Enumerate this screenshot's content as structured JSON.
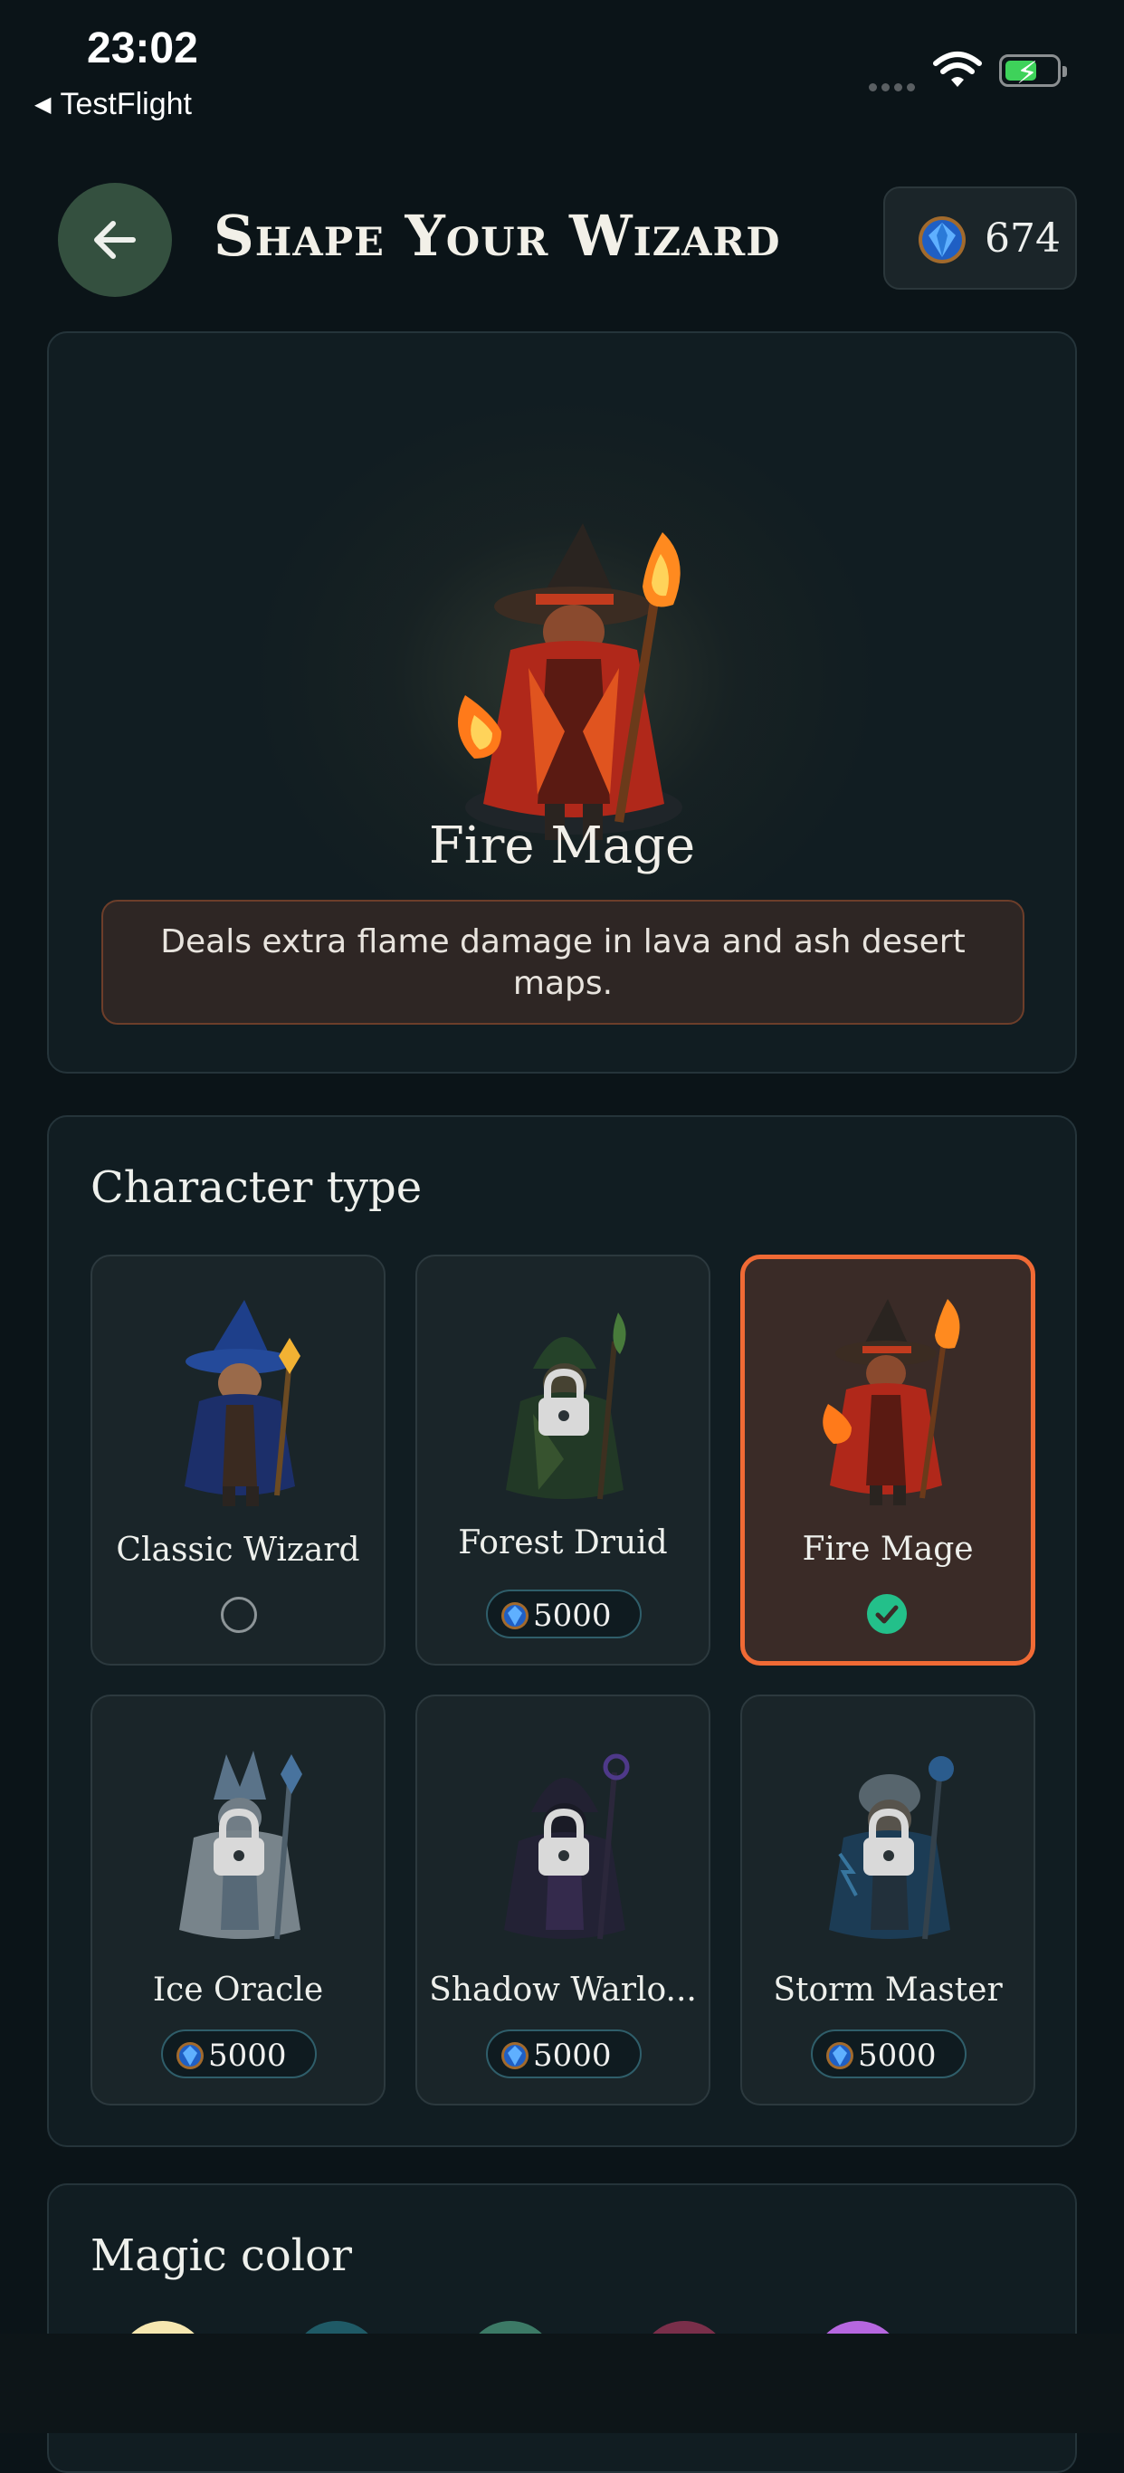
{
  "status": {
    "time": "23:02",
    "back_app": "TestFlight"
  },
  "header": {
    "title": "Shape Your Wizard",
    "gems": "674"
  },
  "preview": {
    "name": "Fire Mage",
    "description": "Deals extra flame damage in lava and ash desert maps."
  },
  "character_type": {
    "title": "Character type",
    "items": [
      {
        "name": "Classic Wizard",
        "locked": false,
        "selected": false
      },
      {
        "name": "Forest Druid",
        "locked": true,
        "price": "5000",
        "selected": false
      },
      {
        "name": "Fire Mage",
        "locked": false,
        "selected": true
      },
      {
        "name": "Ice Oracle",
        "locked": true,
        "price": "5000",
        "selected": false
      },
      {
        "name": "Shadow Warlo...",
        "locked": true,
        "price": "5000",
        "selected": false
      },
      {
        "name": "Storm Master",
        "locked": true,
        "price": "5000",
        "selected": false
      }
    ]
  },
  "magic_color": {
    "title": "Magic color",
    "swatches": [
      "#f6e7b0",
      "#1f5a66",
      "#3c7a66",
      "#7a2f4a",
      "#b667e0"
    ]
  },
  "colors": {
    "accent": "#f06a35",
    "selected_check": "#23c08a",
    "gem": "#2a7ad8"
  }
}
